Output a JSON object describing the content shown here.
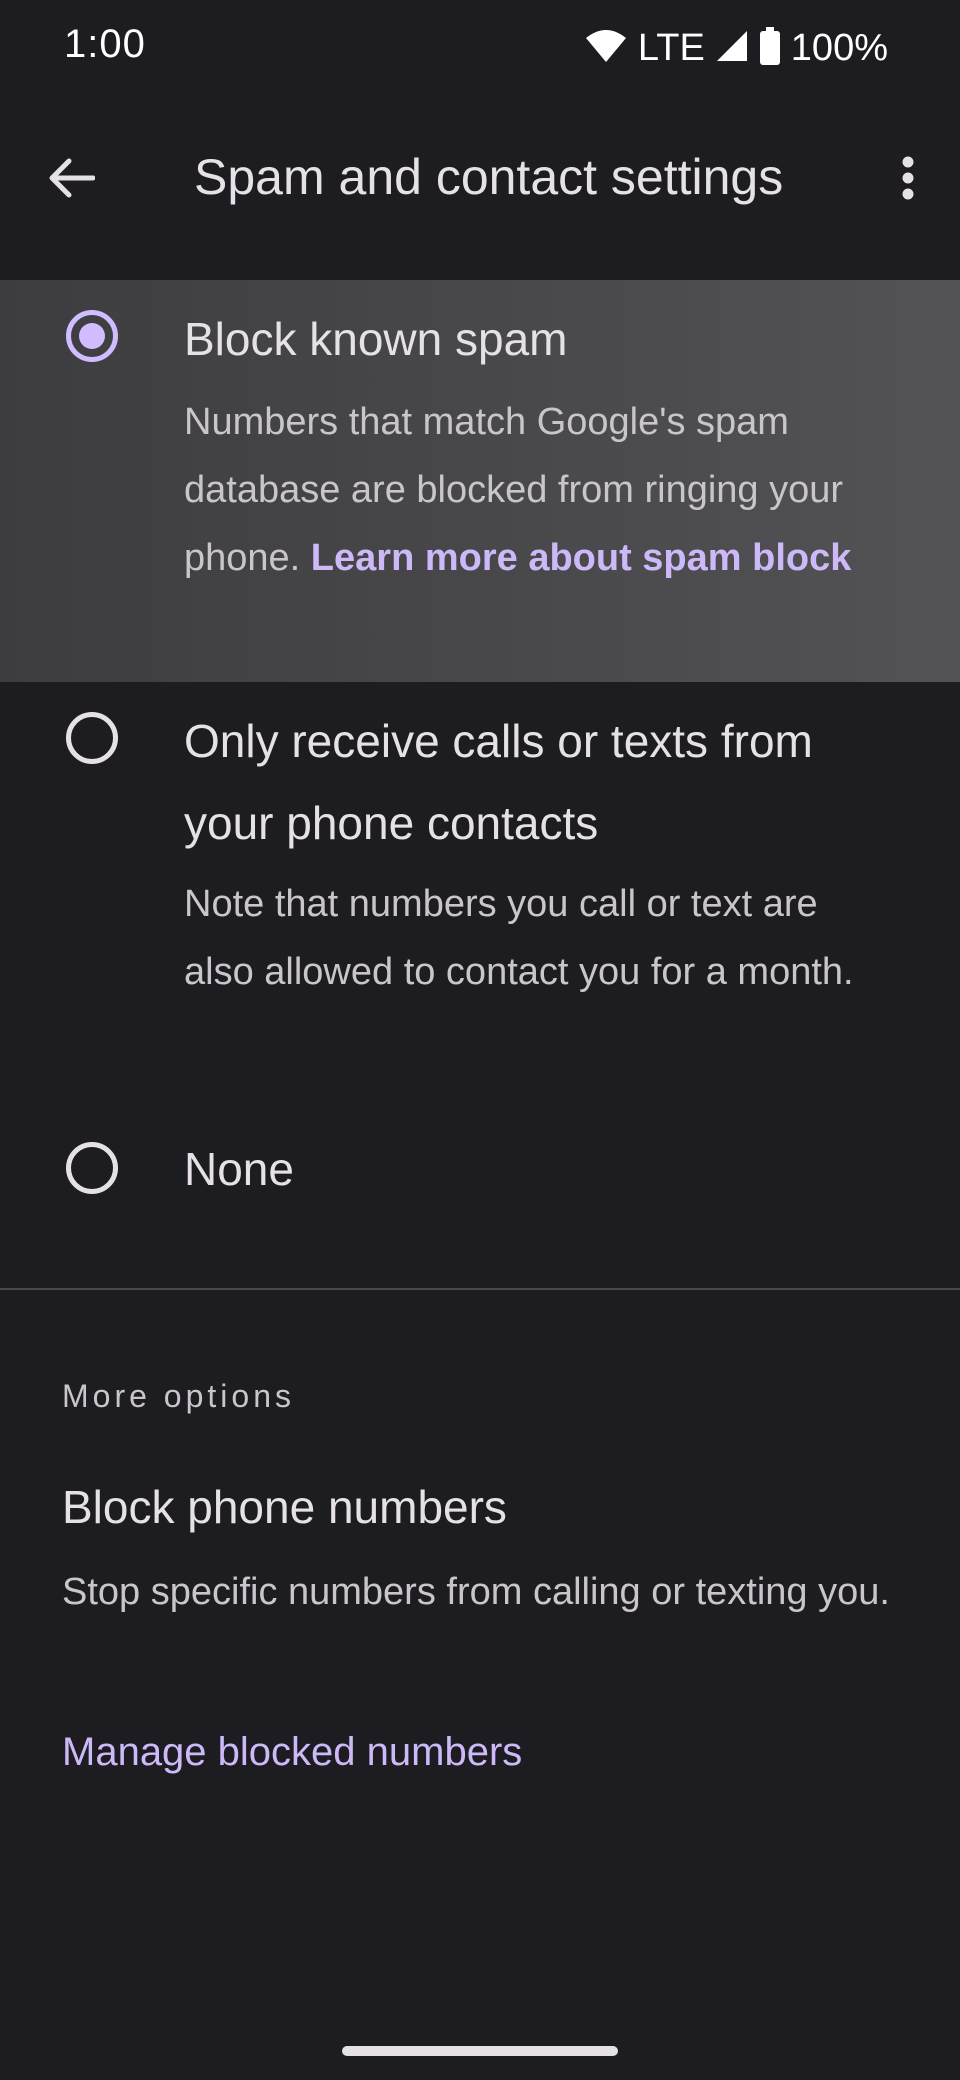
{
  "status_bar": {
    "time": "1:00",
    "network": "LTE",
    "battery": "100%"
  },
  "app_bar": {
    "title": "Spam and contact settings",
    "back_icon": "arrow-back-icon",
    "more_icon": "more-vert-icon"
  },
  "options": [
    {
      "title": "Block known spam",
      "description": "Numbers that match Google's spam database are blocked from ringing your phone. ",
      "link": "Learn more about spam block",
      "selected": true
    },
    {
      "title": "Only receive calls or texts from your phone contacts",
      "description": "Note that numbers you call or text are also allowed to contact you for a month.",
      "selected": false
    },
    {
      "title": "None",
      "selected": false
    }
  ],
  "more_options": {
    "label": "More options",
    "block_numbers": {
      "title": "Block phone numbers",
      "description": "Stop specific numbers from calling or texting you.",
      "link": "Manage blocked numbers"
    }
  },
  "colors": {
    "background": "#1d1c21",
    "accent": "#d0bcff",
    "link": "#cdb8f8"
  }
}
